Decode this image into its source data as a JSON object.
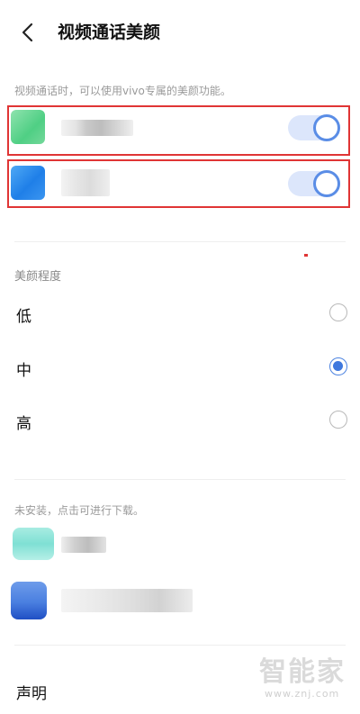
{
  "header": {
    "title": "视频通话美颜",
    "back_icon": "chevron-left-icon"
  },
  "section1": {
    "hint": "视频通话时，可以使用vivo专属的美颜功能。",
    "apps": [
      {
        "icon_color": "#5fd08a",
        "enabled": true
      },
      {
        "icon_color": "#2f8ff0",
        "enabled": true
      }
    ]
  },
  "level": {
    "title": "美颜程度",
    "options": [
      {
        "label": "低",
        "checked": false
      },
      {
        "label": "中",
        "checked": true
      },
      {
        "label": "高",
        "checked": false
      }
    ]
  },
  "section2": {
    "hint": "未安装，点击可进行下载。"
  },
  "footer": {
    "statement": "声明"
  },
  "watermark": {
    "big": "智能家",
    "small": "www.znj.com"
  },
  "colors": {
    "accent": "#3f78de",
    "highlight": "#e03535"
  }
}
